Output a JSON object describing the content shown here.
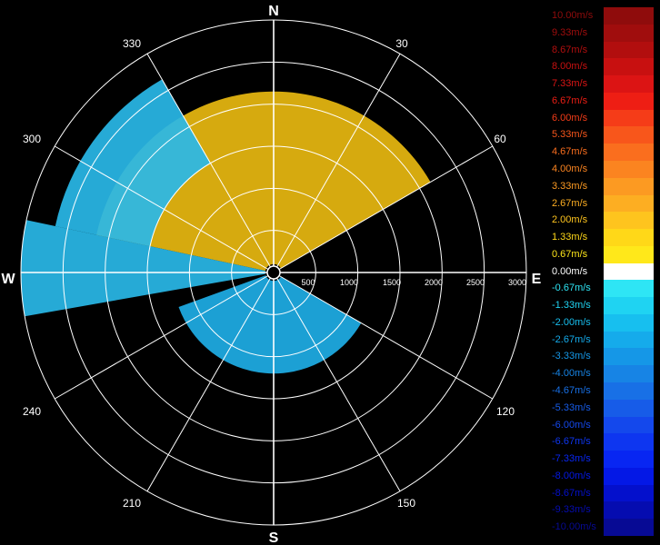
{
  "chart_data": {
    "type": "heatmap",
    "subtype": "polar-radar-velocity-ppi",
    "compass": {
      "north": "N",
      "east": "E",
      "south": "S",
      "west": "W"
    },
    "azimuth_labels": [
      "30",
      "60",
      "120",
      "150",
      "210",
      "240",
      "300",
      "330"
    ],
    "azimuth_values_deg": [
      30,
      60,
      120,
      150,
      210,
      240,
      300,
      330
    ],
    "range_labels": [
      "500",
      "1000",
      "1500",
      "2000",
      "2500",
      "3000"
    ],
    "range_values_m": [
      500,
      1000,
      1500,
      2000,
      2500,
      3000
    ],
    "max_range_m": 3000,
    "unit": "m/s",
    "colorbar": {
      "levels": [
        {
          "label": "10.00m/s",
          "value": 10.0,
          "color": "#8f0c0c"
        },
        {
          "label": "9.33m/s",
          "value": 9.33,
          "color": "#a00d0d"
        },
        {
          "label": "8.67m/s",
          "value": 8.67,
          "color": "#b20e0e"
        },
        {
          "label": "8.00m/s",
          "value": 8.0,
          "color": "#c81010"
        },
        {
          "label": "7.33m/s",
          "value": 7.33,
          "color": "#dc1414"
        },
        {
          "label": "6.67m/s",
          "value": 6.67,
          "color": "#ee1e14"
        },
        {
          "label": "6.00m/s",
          "value": 6.0,
          "color": "#f53c18"
        },
        {
          "label": "5.33m/s",
          "value": 5.33,
          "color": "#f8561b"
        },
        {
          "label": "4.67m/s",
          "value": 4.67,
          "color": "#fa6e1e"
        },
        {
          "label": "4.00m/s",
          "value": 4.0,
          "color": "#fb8420"
        },
        {
          "label": "3.33m/s",
          "value": 3.33,
          "color": "#fc9a22"
        },
        {
          "label": "2.67m/s",
          "value": 2.67,
          "color": "#fdae22"
        },
        {
          "label": "2.00m/s",
          "value": 2.0,
          "color": "#fec41e"
        },
        {
          "label": "1.33m/s",
          "value": 1.33,
          "color": "#ffd818"
        },
        {
          "label": "0.67m/s",
          "value": 0.67,
          "color": "#ffe81a"
        },
        {
          "label": "0.00m/s",
          "value": 0.0,
          "color": "#ffffff"
        },
        {
          "label": "-0.67m/s",
          "value": -0.67,
          "color": "#2ee5f5"
        },
        {
          "label": "-1.33m/s",
          "value": -1.33,
          "color": "#1fd3f2"
        },
        {
          "label": "-2.00m/s",
          "value": -2.0,
          "color": "#17bfef"
        },
        {
          "label": "-2.67m/s",
          "value": -2.67,
          "color": "#15abeb"
        },
        {
          "label": "-3.33m/s",
          "value": -3.33,
          "color": "#1597e7"
        },
        {
          "label": "-4.00m/s",
          "value": -4.0,
          "color": "#1784e5"
        },
        {
          "label": "-4.67m/s",
          "value": -4.67,
          "color": "#1870e6"
        },
        {
          "label": "-5.33m/s",
          "value": -5.33,
          "color": "#175ce8"
        },
        {
          "label": "-6.00m/s",
          "value": -6.0,
          "color": "#1448ec"
        },
        {
          "label": "-6.67m/s",
          "value": -6.67,
          "color": "#0e36f0"
        },
        {
          "label": "-7.33m/s",
          "value": -7.33,
          "color": "#0826f2"
        },
        {
          "label": "-8.00m/s",
          "value": -8.0,
          "color": "#0418e6"
        },
        {
          "label": "-8.67m/s",
          "value": -8.67,
          "color": "#0410cc"
        },
        {
          "label": "-9.33m/s",
          "value": -9.33,
          "color": "#050cb0"
        },
        {
          "label": "-10.00m/s",
          "value": -10.0,
          "color": "#070a94"
        }
      ]
    },
    "echo_regions": [
      {
        "description_color": "#e8b810",
        "az_start_deg": 282,
        "az_end_deg": 60,
        "range_min_m": 100,
        "range_max_m": 2150
      },
      {
        "description_color": "#29b8e8",
        "az_start_deg": 260,
        "az_end_deg": 282,
        "range_min_m": 100,
        "range_max_m": 3000
      },
      {
        "description_color": "#29b8e8",
        "az_start_deg": 282,
        "az_end_deg": 330,
        "range_min_m": 1500,
        "range_max_m": 2650
      },
      {
        "description_color": "#1eaee6",
        "az_start_deg": 120,
        "az_end_deg": 250,
        "range_min_m": 100,
        "range_max_m": 1200
      }
    ]
  }
}
